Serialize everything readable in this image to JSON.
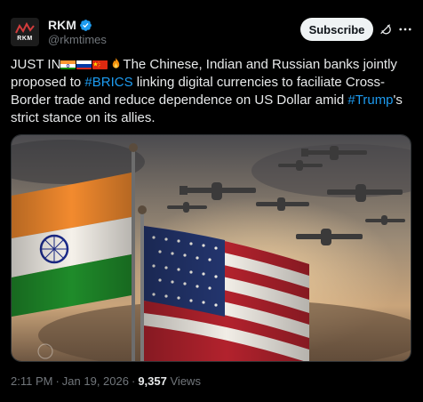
{
  "author": {
    "name": "RKM",
    "handle": "@rkmtimes",
    "avatar_text": "RKM"
  },
  "actions": {
    "subscribe_label": "Subscribe"
  },
  "post": {
    "prefix": "JUST IN",
    "segments": [
      {
        "text": "The Chinese, Indian and Russian banks jointly proposed to ",
        "link": false
      },
      {
        "text": "#BRICS",
        "link": true
      },
      {
        "text": " linking digital currencies to faciliate Cross-Border trade and reduce dependence on US Dollar amid ",
        "link": false
      },
      {
        "text": "#Trump",
        "link": true
      },
      {
        "text": "'s strict stance on its allies.",
        "link": false
      }
    ]
  },
  "meta": {
    "time": "2:11 PM",
    "date": "Jan 19, 2026",
    "views_count": "9,357",
    "views_label": "Views"
  },
  "colors": {
    "background": "#000000",
    "text": "#e7e9ea",
    "muted": "#71767b",
    "link": "#1d9bf0",
    "verified": "#1d9bf0",
    "subscribe_bg": "#eff3f4"
  },
  "icons": {
    "verified": "verified-badge-icon",
    "grok": "grok-icon",
    "more": "more-icon",
    "flag_india": "india-flag-icon",
    "flag_russia": "russia-flag-icon",
    "flag_china": "china-flag-icon",
    "fire": "fire-icon"
  }
}
